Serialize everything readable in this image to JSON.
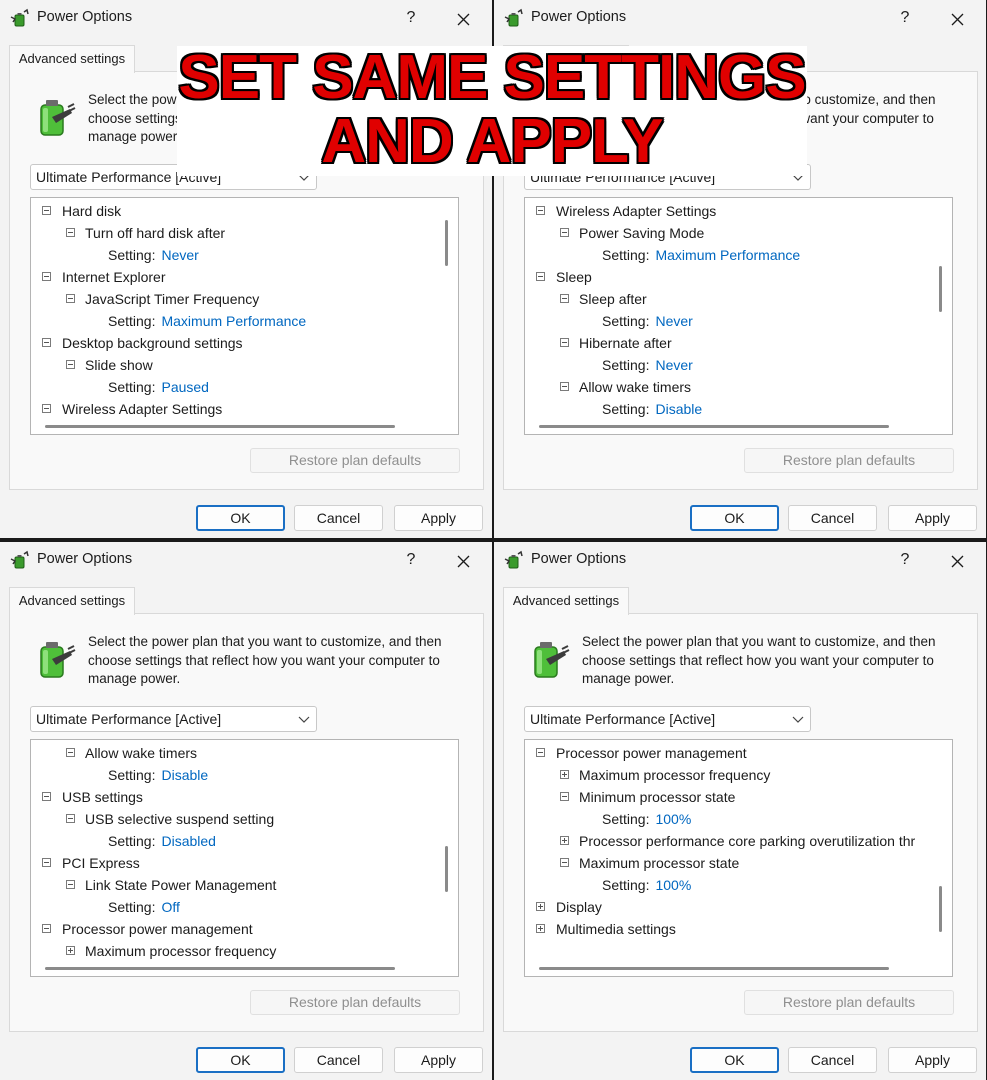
{
  "banner": {
    "line1": "SET SAME SETTINGS",
    "line2": "AND APPLY"
  },
  "dialogs": [
    {
      "title": "Power Options",
      "help": "?",
      "tab": "Advanced settings",
      "description": "Select the power plan that you want to customize, and then choose settings that reflect how you want your computer to manage power.",
      "plan": "Ultimate Performance [Active]",
      "tree": [
        {
          "level": 0,
          "toggle": "minus",
          "text": "Hard disk"
        },
        {
          "level": 1,
          "toggle": "minus",
          "text": "Turn off hard disk after"
        },
        {
          "level": 2,
          "label": "Setting:",
          "value": "Never"
        },
        {
          "level": 0,
          "toggle": "minus",
          "text": "Internet Explorer"
        },
        {
          "level": 1,
          "toggle": "minus",
          "text": "JavaScript Timer Frequency"
        },
        {
          "level": 2,
          "label": "Setting:",
          "value": "Maximum Performance"
        },
        {
          "level": 0,
          "toggle": "minus",
          "text": "Desktop background settings"
        },
        {
          "level": 1,
          "toggle": "minus",
          "text": "Slide show"
        },
        {
          "level": 2,
          "label": "Setting:",
          "value": "Paused"
        },
        {
          "level": 0,
          "toggle": "minus",
          "text": "Wireless Adapter Settings"
        }
      ],
      "restore": "Restore plan defaults",
      "ok": "OK",
      "cancel": "Cancel",
      "apply": "Apply"
    },
    {
      "title": "Power Options",
      "help": "?",
      "tab": "Advanced settings",
      "description": "Select the power plan that you want to customize, and then choose settings that reflect how you want your computer to manage power.",
      "plan": "Ultimate Performance [Active]",
      "tree": [
        {
          "level": 0,
          "toggle": "minus",
          "text": "Wireless Adapter Settings"
        },
        {
          "level": 1,
          "toggle": "minus",
          "text": "Power Saving Mode"
        },
        {
          "level": 2,
          "label": "Setting:",
          "value": "Maximum Performance"
        },
        {
          "level": 0,
          "toggle": "minus",
          "text": "Sleep"
        },
        {
          "level": 1,
          "toggle": "minus",
          "text": "Sleep after"
        },
        {
          "level": 2,
          "label": "Setting:",
          "value": "Never"
        },
        {
          "level": 1,
          "toggle": "minus",
          "text": "Hibernate after"
        },
        {
          "level": 2,
          "label": "Setting:",
          "value": "Never"
        },
        {
          "level": 1,
          "toggle": "minus",
          "text": "Allow wake timers"
        },
        {
          "level": 2,
          "label": "Setting:",
          "value": "Disable"
        }
      ],
      "restore": "Restore plan defaults",
      "ok": "OK",
      "cancel": "Cancel",
      "apply": "Apply"
    },
    {
      "title": "Power Options",
      "help": "?",
      "tab": "Advanced settings",
      "description": "Select the power plan that you want to customize, and then choose settings that reflect how you want your computer to manage power.",
      "plan": "Ultimate Performance [Active]",
      "tree": [
        {
          "level": 1,
          "toggle": "minus",
          "text": "Allow wake timers"
        },
        {
          "level": 2,
          "label": "Setting:",
          "value": "Disable"
        },
        {
          "level": 0,
          "toggle": "minus",
          "text": "USB settings"
        },
        {
          "level": 1,
          "toggle": "minus",
          "text": "USB selective suspend setting"
        },
        {
          "level": 2,
          "label": "Setting:",
          "value": "Disabled"
        },
        {
          "level": 0,
          "toggle": "minus",
          "text": "PCI Express"
        },
        {
          "level": 1,
          "toggle": "minus",
          "text": "Link State Power Management"
        },
        {
          "level": 2,
          "label": "Setting:",
          "value": "Off"
        },
        {
          "level": 0,
          "toggle": "minus",
          "text": "Processor power management"
        },
        {
          "level": 1,
          "toggle": "plus",
          "text": "Maximum processor frequency"
        }
      ],
      "restore": "Restore plan defaults",
      "ok": "OK",
      "cancel": "Cancel",
      "apply": "Apply"
    },
    {
      "title": "Power Options",
      "help": "?",
      "tab": "Advanced settings",
      "description": "Select the power plan that you want to customize, and then choose settings that reflect how you want your computer to manage power.",
      "plan": "Ultimate Performance [Active]",
      "tree": [
        {
          "level": 0,
          "toggle": "minus",
          "text": "Processor power management"
        },
        {
          "level": 1,
          "toggle": "plus",
          "text": "Maximum processor frequency"
        },
        {
          "level": 1,
          "toggle": "minus",
          "text": "Minimum processor state"
        },
        {
          "level": 2,
          "label": "Setting:",
          "value": "100%"
        },
        {
          "level": 1,
          "toggle": "plus",
          "text": "Processor performance core parking overutilization thr"
        },
        {
          "level": 1,
          "toggle": "minus",
          "text": "Maximum processor state"
        },
        {
          "level": 2,
          "label": "Setting:",
          "value": "100%"
        },
        {
          "level": 0,
          "toggle": "plus",
          "text": "Display"
        },
        {
          "level": 0,
          "toggle": "plus",
          "text": "Multimedia settings"
        }
      ],
      "restore": "Restore plan defaults",
      "ok": "OK",
      "cancel": "Cancel",
      "apply": "Apply"
    }
  ]
}
